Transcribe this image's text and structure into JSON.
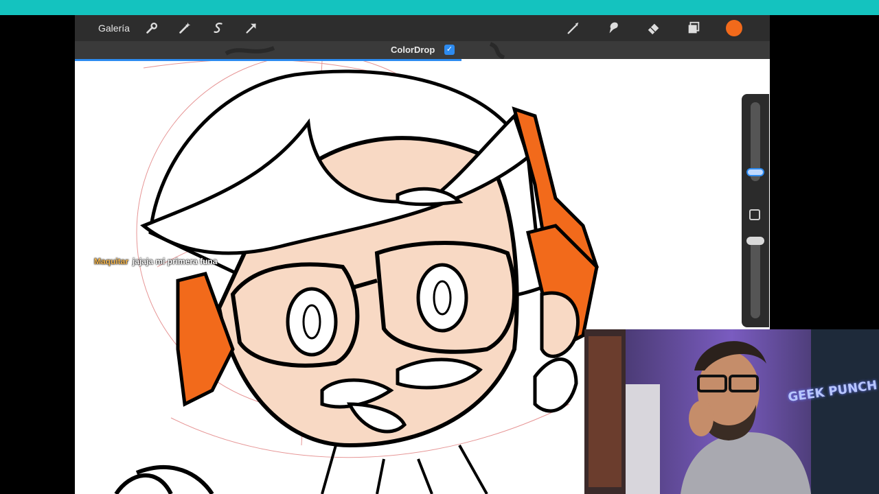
{
  "toolbar": {
    "gallery_label": "Galería",
    "left_tools": [
      "wrench-icon",
      "magic-wand-icon",
      "selection-icon",
      "transform-arrow-icon"
    ],
    "right_tools": [
      "brush-icon",
      "smudge-icon",
      "eraser-icon",
      "layers-icon"
    ],
    "current_color": "#f26a1b"
  },
  "subbar": {
    "mode_label": "ColorDrop",
    "mode_checked": true
  },
  "chat": {
    "username": "Maquitar",
    "message": "jajaja mi primera funa"
  },
  "webcam": {
    "sign_text": "GEEK PUNCH"
  },
  "colors": {
    "accent": "#2d8bf0",
    "top_strip": "#14c3bf",
    "toolbar_bg": "#2d2d2d",
    "drawing_orange": "#f26a1b",
    "skin": "#f8d9c4"
  }
}
